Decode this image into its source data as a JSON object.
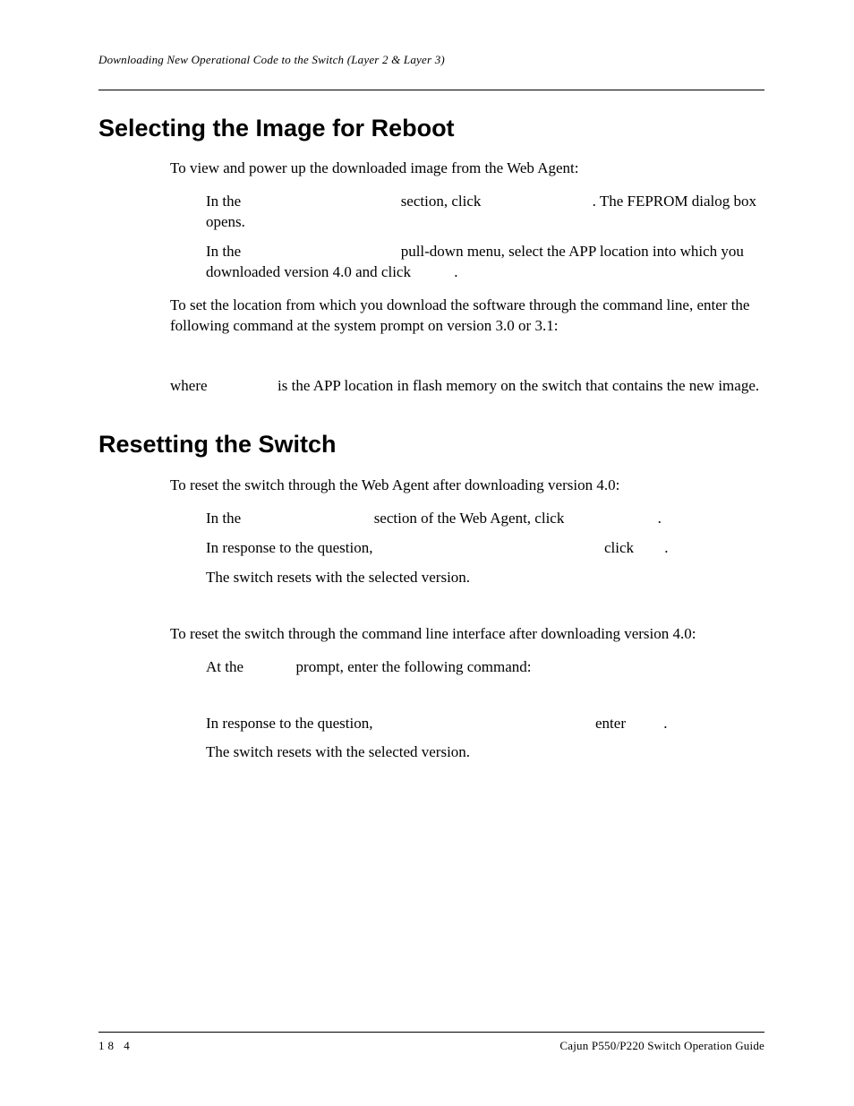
{
  "header": {
    "running": "Downloading New Operational Code to the Switch (Layer 2 & Layer 3)"
  },
  "sections": {
    "select": {
      "title": "Selecting the Image for Reboot",
      "intro": "To view and power up the downloaded image from the Web Agent:",
      "step1_a": "In the ",
      "step1_b": " section, click ",
      "step1_c": ". The FEPROM dialog box opens.",
      "step2_a": "In the ",
      "step2_b": " pull-down menu, select the APP location into which you downloaded version 4.0 and click ",
      "step2_c": ".",
      "cli_intro": "To set the location from which you download the software through the command line, enter the following command at the system prompt on version 3.0 or 3.1:",
      "where_a": "where ",
      "where_b": " is the APP location in flash memory on the switch that contains the new image."
    },
    "reset": {
      "title": "Resetting the Switch",
      "web_intro": "To reset the switch through the Web Agent after downloading version 4.0:",
      "w1_a": "In the ",
      "w1_b": " section of the Web Agent, click ",
      "w1_c": ".",
      "w2_a": "In response to the question, ",
      "w2_b": " click ",
      "w2_c": ".",
      "w3": "The switch resets with the selected version.",
      "cli_intro": "To reset the switch through the command line interface after downloading version 4.0:",
      "c1_a": "At the ",
      "c1_b": " prompt, enter the following command:",
      "c2_a": "In response to the question, ",
      "c2_b": " enter ",
      "c2_c": ".",
      "c3": "The switch resets with the selected version."
    }
  },
  "footer": {
    "page": "18 4",
    "doc": "Cajun P550/P220 Switch Operation Guide"
  }
}
